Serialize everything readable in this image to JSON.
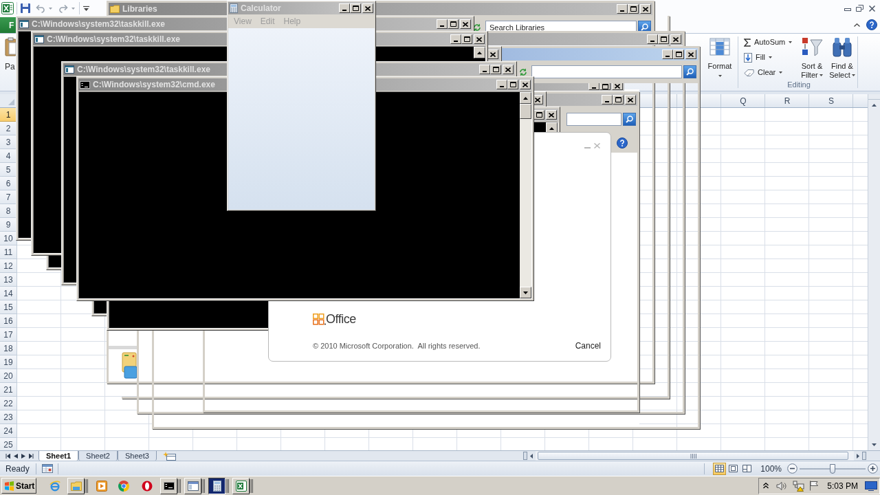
{
  "excel": {
    "ribbon": {
      "file_tab": "F",
      "paste_label": "Pa",
      "format_label": "Format",
      "autosum": "AutoSum",
      "fill": "Fill",
      "clear": "Clear",
      "sort_filter": [
        "Sort &",
        "Filter"
      ],
      "find_select": [
        "Find &",
        "Select"
      ],
      "group_label": "Editing"
    },
    "column_headers": [
      "Q",
      "R",
      "S"
    ],
    "row_headers": [
      {
        "label": "1",
        "selected": true
      },
      {
        "label": "2",
        "selected": false
      },
      {
        "label": "3",
        "selected": false
      },
      {
        "label": "4",
        "selected": false
      },
      {
        "label": "5",
        "selected": false
      },
      {
        "label": "6",
        "selected": false
      },
      {
        "label": "7",
        "selected": false
      },
      {
        "label": "8",
        "selected": false
      },
      {
        "label": "9",
        "selected": false
      },
      {
        "label": "10",
        "selected": false
      },
      {
        "label": "11",
        "selected": false
      },
      {
        "label": "12",
        "selected": false
      },
      {
        "label": "13",
        "selected": false
      },
      {
        "label": "14",
        "selected": false
      },
      {
        "label": "15",
        "selected": false
      },
      {
        "label": "16",
        "selected": false
      },
      {
        "label": "17",
        "selected": false
      },
      {
        "label": "18",
        "selected": false
      },
      {
        "label": "19",
        "selected": false
      },
      {
        "label": "20",
        "selected": false
      },
      {
        "label": "21",
        "selected": false
      },
      {
        "label": "22",
        "selected": false
      },
      {
        "label": "23",
        "selected": false
      },
      {
        "label": "24",
        "selected": false
      },
      {
        "label": "25",
        "selected": false
      }
    ],
    "sheet_tabs": [
      {
        "label": "Sheet1",
        "selected": true
      },
      {
        "label": "Sheet2",
        "selected": false
      },
      {
        "label": "Sheet3",
        "selected": false
      }
    ],
    "status_bar": {
      "status": "Ready",
      "views": [
        {
          "kind": "normal",
          "selected": true
        },
        {
          "kind": "page_layout",
          "selected": false
        },
        {
          "kind": "page_break",
          "selected": false
        }
      ],
      "zoom": "100%",
      "zoom_slider": {
        "level": 0.5
      }
    }
  },
  "windows": [
    {
      "kind": "explorer",
      "title": "Libraries",
      "search_placeholder": "Search Libraries"
    },
    {
      "kind": "console",
      "title": "C:\\Windows\\system32\\taskkill.exe"
    },
    {
      "kind": "console",
      "title": "C:\\Windows\\system32\\taskkill.exe"
    },
    {
      "kind": "console",
      "title": "C:\\Windows\\system32\\taskkill.exe"
    },
    {
      "kind": "console",
      "title": "C:\\Windows\\system32\\cmd.exe"
    },
    {
      "kind": "calculator",
      "title": "Calculator",
      "menu": [
        "View",
        "Edit",
        "Help"
      ]
    },
    {
      "kind": "splash",
      "logo": "Office",
      "copyright": "© 2010 Microsoft Corporation.  All rights reserved.",
      "cancel": "Cancel"
    }
  ],
  "taskbar": {
    "start": "Start",
    "buttons": [
      {
        "kind": "console",
        "selected": false
      },
      {
        "kind": "window",
        "selected": false
      },
      {
        "kind": "calculator",
        "selected": true
      },
      {
        "kind": "spreadsheet",
        "selected": false
      }
    ],
    "clock": "5:03 PM"
  }
}
